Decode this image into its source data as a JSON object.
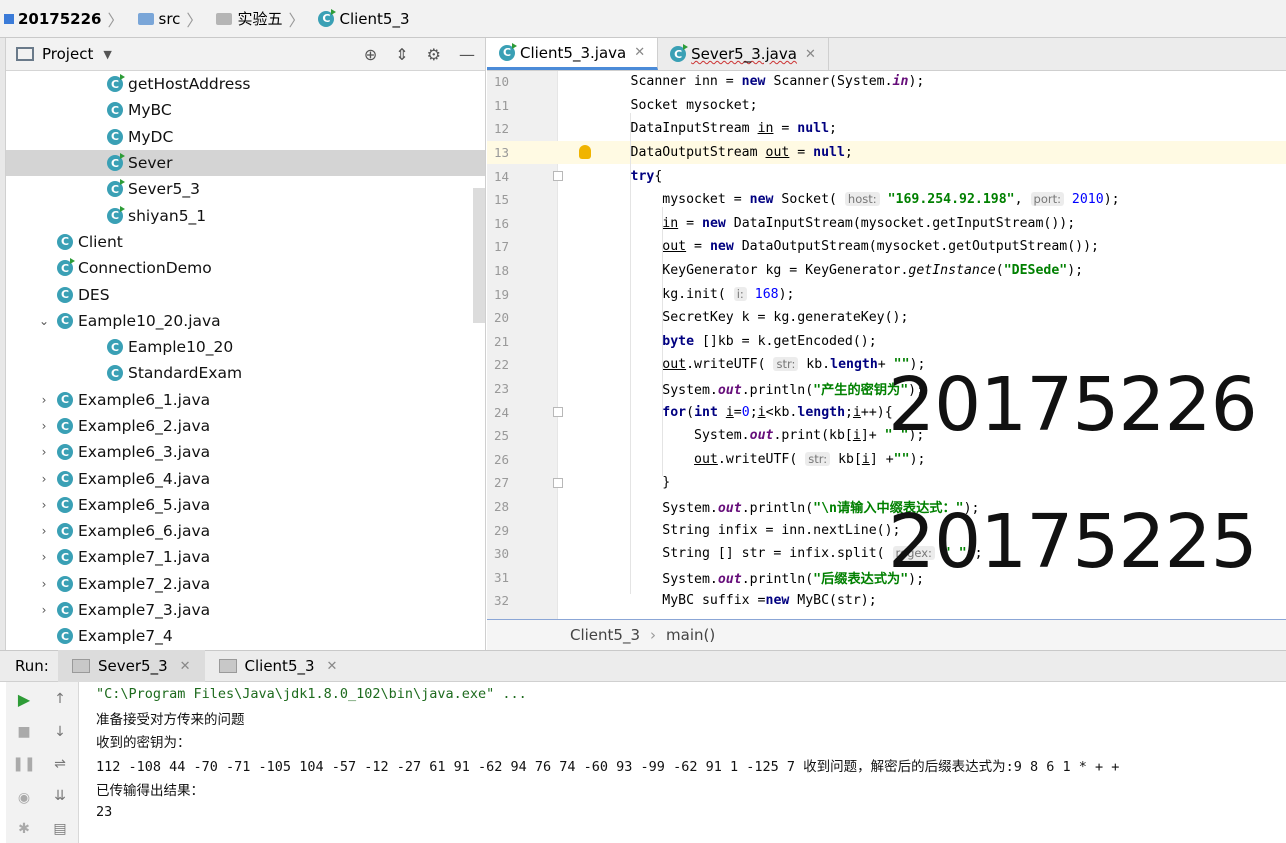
{
  "breadcrumb": {
    "project": "20175226",
    "folder1": "src",
    "folder2": "实验五",
    "file": "Client5_3"
  },
  "project_panel": {
    "title": "Project",
    "items": [
      {
        "label": "getHostAddress",
        "depth": 2,
        "arrow": "",
        "run": true
      },
      {
        "label": "MyBC",
        "depth": 2,
        "arrow": "",
        "run": false
      },
      {
        "label": "MyDC",
        "depth": 2,
        "arrow": "",
        "run": false
      },
      {
        "label": "Sever",
        "depth": 2,
        "arrow": "",
        "run": true,
        "selected": true
      },
      {
        "label": "Sever5_3",
        "depth": 2,
        "arrow": "",
        "run": true
      },
      {
        "label": "shiyan5_1",
        "depth": 2,
        "arrow": "",
        "run": true
      },
      {
        "label": "Client",
        "depth": 1,
        "arrow": "",
        "run": false
      },
      {
        "label": "ConnectionDemo",
        "depth": 1,
        "arrow": "",
        "run": true
      },
      {
        "label": "DES",
        "depth": 1,
        "arrow": "",
        "run": false
      },
      {
        "label": "Eample10_20.java",
        "depth": 1,
        "arrow": "⌄",
        "run": false
      },
      {
        "label": "Eample10_20",
        "depth": 2,
        "arrow": "",
        "run": false
      },
      {
        "label": "StandardExam",
        "depth": 2,
        "arrow": "",
        "run": false
      },
      {
        "label": "Example6_1.java",
        "depth": 1,
        "arrow": "›",
        "run": false
      },
      {
        "label": "Example6_2.java",
        "depth": 1,
        "arrow": "›",
        "run": false
      },
      {
        "label": "Example6_3.java",
        "depth": 1,
        "arrow": "›",
        "run": false
      },
      {
        "label": "Example6_4.java",
        "depth": 1,
        "arrow": "›",
        "run": false
      },
      {
        "label": "Example6_5.java",
        "depth": 1,
        "arrow": "›",
        "run": false
      },
      {
        "label": "Example6_6.java",
        "depth": 1,
        "arrow": "›",
        "run": false
      },
      {
        "label": "Example7_1.java",
        "depth": 1,
        "arrow": "›",
        "run": false
      },
      {
        "label": "Example7_2.java",
        "depth": 1,
        "arrow": "›",
        "run": false
      },
      {
        "label": "Example7_3.java",
        "depth": 1,
        "arrow": "›",
        "run": false
      },
      {
        "label": "Example7_4",
        "depth": 1,
        "arrow": "",
        "run": false
      }
    ]
  },
  "editor": {
    "tabs": [
      {
        "label": "Client5_3.java",
        "active": true
      },
      {
        "label": "Sever5_3.java",
        "active": false
      }
    ],
    "status_class": "Client5_3",
    "status_method": "main()"
  },
  "code_lines": [
    {
      "n": "10",
      "html": "        Scanner inn = <span class=\"kw\">new</span> Scanner(System.<span class=\"fld\">in</span>);"
    },
    {
      "n": "11",
      "html": "        Socket mysocket;"
    },
    {
      "n": "12",
      "html": "        DataInputStream <span class=\"ul\">in</span> = <span class=\"kw\">null</span>;"
    },
    {
      "n": "13",
      "html": "        DataOutputStream <span class=\"ul\">out</span> = <span class=\"kw\">null</span>;"
    },
    {
      "n": "14",
      "html": "        <span class=\"kw\">try</span>{"
    },
    {
      "n": "15",
      "html": "            mysocket = <span class=\"kw\">new</span> Socket( <span class=\"hint\">host:</span> <span class=\"str\">\"169.254.92.198\"</span>, <span class=\"hint\">port:</span> <span class=\"num\">2010</span>);"
    },
    {
      "n": "16",
      "html": "            <span class=\"ul\">in</span> = <span class=\"kw\">new</span> DataInputStream(mysocket.getInputStream());"
    },
    {
      "n": "17",
      "html": "            <span class=\"ul\">out</span> = <span class=\"kw\">new</span> DataOutputStream(mysocket.getOutputStream());"
    },
    {
      "n": "18",
      "html": "            KeyGenerator kg = KeyGenerator.<span class=\"ita\">getInstance</span>(<span class=\"str\">\"DESede\"</span>);"
    },
    {
      "n": "19",
      "html": "            kg.init( <span class=\"hint\">i:</span> <span class=\"num\">168</span>);"
    },
    {
      "n": "20",
      "html": "            SecretKey k = kg.generateKey();"
    },
    {
      "n": "21",
      "html": "            <span class=\"kw\">byte</span> []kb = k.getEncoded();"
    },
    {
      "n": "22",
      "html": "            <span class=\"ul\">out</span>.writeUTF( <span class=\"hint\">str:</span> kb.<span class=\"kw\">length</span>+ <span class=\"str\">\"\"</span>);"
    },
    {
      "n": "23",
      "html": "            System.<span class=\"fld\">out</span>.println(<span class=\"str\">\"产生的密钥为\"</span>);"
    },
    {
      "n": "24",
      "html": "            <span class=\"kw\">for</span>(<span class=\"kw\">int</span> <span class=\"ul\">i</span>=<span class=\"num\">0</span>;<span class=\"ul\">i</span>&lt;kb.<span class=\"kw\">length</span>;<span class=\"ul\">i</span>++){"
    },
    {
      "n": "25",
      "html": "                System.<span class=\"fld\">out</span>.print(kb[<span class=\"ul\">i</span>]+ <span class=\"str\">\" \"</span>);"
    },
    {
      "n": "26",
      "html": "                <span class=\"ul\">out</span>.writeUTF( <span class=\"hint\">str:</span> kb[<span class=\"ul\">i</span>] +<span class=\"str\">\"\"</span>);"
    },
    {
      "n": "27",
      "html": "            }"
    },
    {
      "n": "28",
      "html": "            System.<span class=\"fld\">out</span>.println(<span class=\"str\">\"\\n请输入中缀表达式：\"</span>);"
    },
    {
      "n": "29",
      "html": "            String infix = inn.nextLine();"
    },
    {
      "n": "30",
      "html": "            String [] str = infix.split( <span class=\"hint\">regex:</span> <span class=\"str\">\" \"</span>);"
    },
    {
      "n": "31",
      "html": "            System.<span class=\"fld\">out</span>.println(<span class=\"str\">\"后缀表达式为\"</span>);"
    },
    {
      "n": "32",
      "html": "            MyBC suffix =<span class=\"kw\">new</span> MyBC(str);"
    }
  ],
  "overlay": {
    "line1": "20175226",
    "line2": "20175225"
  },
  "run_panel": {
    "label": "Run:",
    "tabs": [
      {
        "label": "Sever5_3",
        "active": true
      },
      {
        "label": "Client5_3",
        "active": false
      }
    ],
    "console_lines": [
      "\"C:\\Program Files\\Java\\jdk1.8.0_102\\bin\\java.exe\" ...",
      "准备接受对方传来的问题",
      "收到的密钥为：",
      "112 -108 44 -70 -71 -105 104 -57 -12 -27 61 91 -62 94 76 74 -60 93 -99 -62 91 1 -125 7 收到问题，解密后的后缀表达式为:9 8 6 1 * + +",
      "已传输得出结果：",
      "23"
    ]
  }
}
